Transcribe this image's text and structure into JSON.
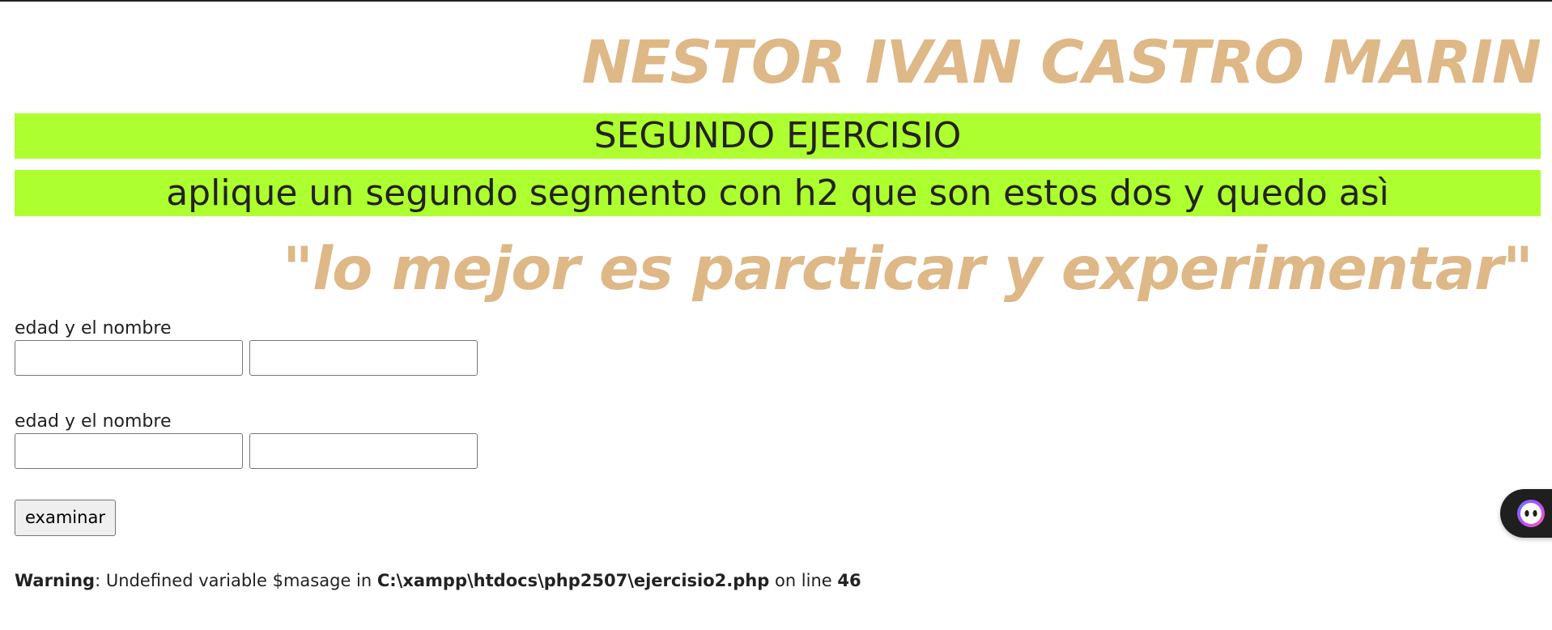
{
  "header": {
    "name": "NESTOR IVAN CASTRO MARIN"
  },
  "banners": {
    "title": "SEGUNDO EJERCISIO",
    "subtitle": "aplique un segundo segmento con h2 que son estos dos y quedo asì"
  },
  "quote": "\"lo mejor es parcticar y experimentar\"",
  "form": {
    "group_1": {
      "label": "edad y el nombre",
      "field_a_value": "",
      "field_b_value": ""
    },
    "group_2": {
      "label": "edad y el nombre",
      "field_a_value": "",
      "field_b_value": ""
    },
    "submit_label": "examinar"
  },
  "warning": {
    "label": "Warning",
    "message": ": Undefined variable $masage in ",
    "path": "C:\\xampp\\htdocs\\php2507\\ejercisio2.php",
    "on_line": " on line ",
    "line": "46"
  },
  "assistant_widget": {
    "icon": "assistant-face-icon"
  },
  "colors": {
    "heading_tan": "#deb887",
    "banner_green": "#adff2f",
    "text_dark": "#222222",
    "widget_dark": "#1f1f1f"
  }
}
